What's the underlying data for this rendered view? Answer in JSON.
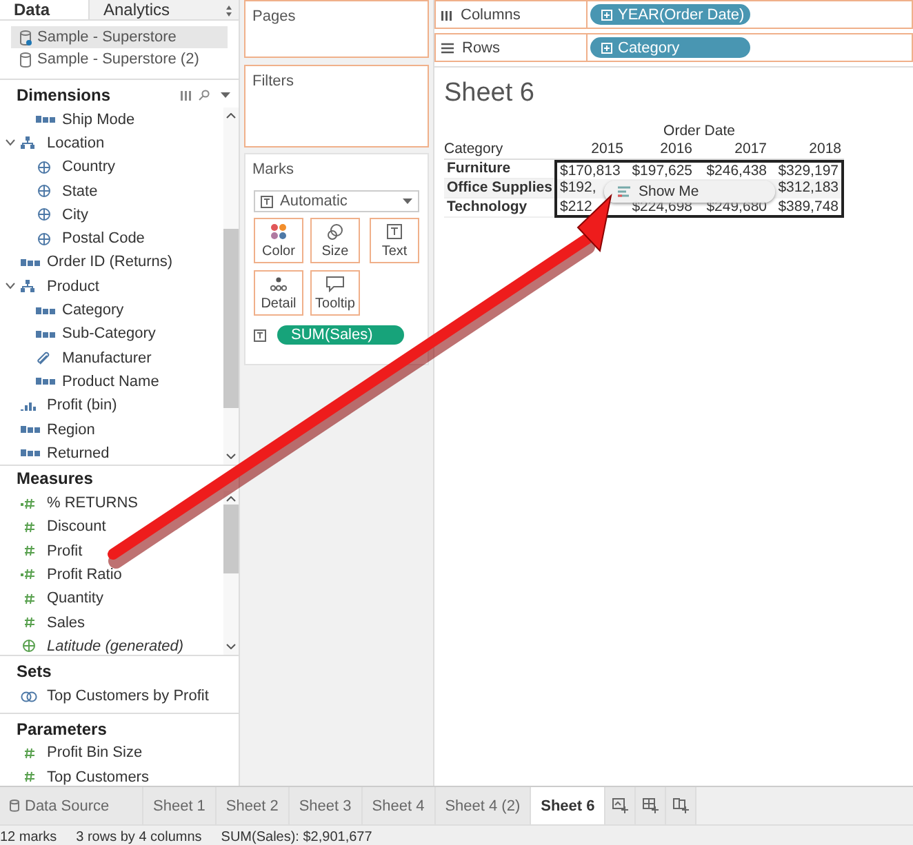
{
  "data_pane": {
    "tabs": [
      {
        "label": "Data",
        "selected": true
      },
      {
        "label": "Analytics",
        "selected": false
      }
    ],
    "sources": [
      {
        "name": "Sample - Superstore",
        "selected": true
      },
      {
        "name": "Sample - Superstore (2)",
        "selected": false
      }
    ],
    "dimensions": {
      "title": "Dimensions",
      "items": [
        {
          "children": [
            {
              "label": "Ship Mode",
              "kind": "string"
            }
          ]
        },
        {
          "label": "Location",
          "kind": "hierarchy",
          "expanded": true,
          "children": [
            {
              "label": "Country",
              "kind": "geo"
            },
            {
              "label": "State",
              "kind": "geo"
            },
            {
              "label": "City",
              "kind": "geo"
            },
            {
              "label": "Postal Code",
              "kind": "geo"
            }
          ]
        },
        {
          "label": "Order ID (Returns)",
          "kind": "string"
        },
        {
          "label": "Product",
          "kind": "hierarchy",
          "expanded": true,
          "children": [
            {
              "label": "Category",
              "kind": "string"
            },
            {
              "label": "Sub-Category",
              "kind": "string"
            },
            {
              "label": "Manufacturer",
              "kind": "group"
            },
            {
              "label": "Product Name",
              "kind": "string"
            }
          ]
        },
        {
          "label": "Profit (bin)",
          "kind": "bin"
        },
        {
          "label": "Region",
          "kind": "string"
        },
        {
          "label": "Returned",
          "kind": "string"
        }
      ]
    },
    "measures": {
      "title": "Measures",
      "items": [
        {
          "label": "% RETURNS",
          "kind": "calc"
        },
        {
          "label": "Discount",
          "kind": "number"
        },
        {
          "label": "Profit",
          "kind": "number"
        },
        {
          "label": "Profit Ratio",
          "kind": "calc"
        },
        {
          "label": "Quantity",
          "kind": "number"
        },
        {
          "label": "Sales",
          "kind": "number"
        },
        {
          "label": "Latitude (generated)",
          "kind": "generated"
        }
      ]
    },
    "sets": {
      "title": "Sets",
      "items": [
        {
          "label": "Top Customers by Profit",
          "kind": "set"
        }
      ]
    },
    "parameters": {
      "title": "Parameters",
      "items": [
        {
          "label": "Profit Bin Size",
          "kind": "number"
        },
        {
          "label": "Top Customers",
          "kind": "number"
        }
      ]
    }
  },
  "shelves": {
    "pages": "Pages",
    "filters": "Filters",
    "marks": {
      "title": "Marks",
      "type": "Automatic",
      "cards": [
        {
          "label": "Color",
          "kind": "color"
        },
        {
          "label": "Size",
          "kind": "size"
        },
        {
          "label": "Text",
          "kind": "text"
        },
        {
          "label": "Detail",
          "kind": "detail"
        },
        {
          "label": "Tooltip",
          "kind": "tooltip"
        }
      ],
      "pills": [
        {
          "label": "SUM(Sales)",
          "kind": "text"
        }
      ]
    }
  },
  "columns": {
    "label": "Columns",
    "pills": [
      "YEAR(Order Date)"
    ]
  },
  "rows": {
    "label": "Rows",
    "pills": [
      "Category"
    ]
  },
  "sheet": {
    "title": "Sheet 6",
    "column_header": "Order Date",
    "row_header": "Category",
    "years": [
      "2015",
      "2016",
      "2017",
      "2018"
    ],
    "rows": [
      {
        "category": "Furniture",
        "cells": [
          "$170,813",
          "$197,625",
          "$246,438",
          "$329,197"
        ]
      },
      {
        "category": "Office Supplies",
        "cells": [
          "$192,",
          null,
          null,
          "$312,183"
        ]
      },
      {
        "category": "Technology",
        "cells": [
          "$212",
          "$224,698",
          "$249,680",
          "$389,748"
        ]
      }
    ],
    "overlay_button": "Show Me"
  },
  "sheet_tabs": [
    {
      "label": "Data Source",
      "kind": "source",
      "selected": false
    },
    {
      "label": "Sheet 1",
      "kind": "sheet",
      "selected": false
    },
    {
      "label": "Sheet 2",
      "kind": "sheet",
      "selected": false
    },
    {
      "label": "Sheet 3",
      "kind": "sheet",
      "selected": false
    },
    {
      "label": "Sheet 4",
      "kind": "sheet",
      "selected": false
    },
    {
      "label": "Sheet 4 (2)",
      "kind": "sheet",
      "selected": false
    },
    {
      "label": "Sheet 6",
      "kind": "sheet",
      "selected": true
    }
  ],
  "status_bar": [
    "12 marks",
    "3 rows by 4 columns",
    "SUM(Sales): $2,901,677"
  ]
}
